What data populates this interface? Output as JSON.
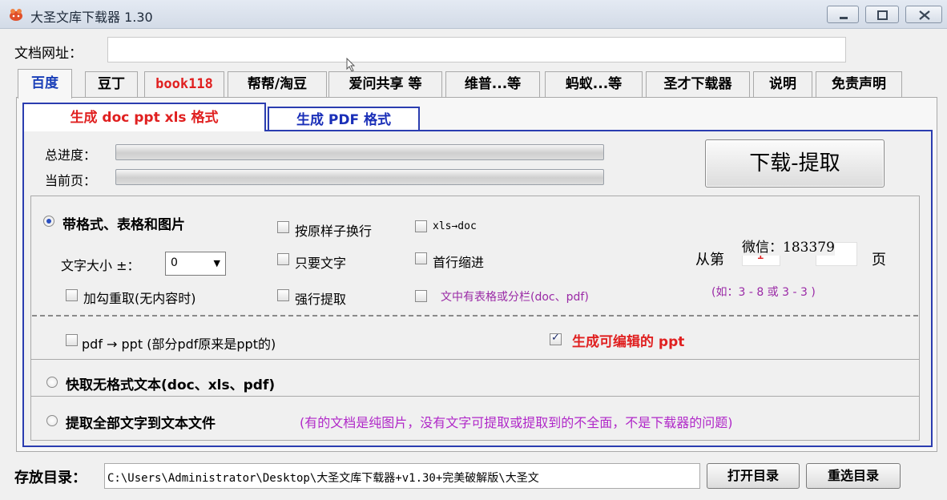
{
  "window": {
    "title": "大圣文库下载器 1.30"
  },
  "url_row": {
    "label": "文档网址：",
    "value": ""
  },
  "tabs": [
    {
      "label": "百度",
      "color": "#1a3fb8"
    },
    {
      "label": "豆丁",
      "color": "#000000"
    },
    {
      "label": "book118",
      "color": "#e02020"
    },
    {
      "label": "帮帮/淘豆",
      "color": "#000000"
    },
    {
      "label": "爱问共享 等",
      "color": "#000000"
    },
    {
      "label": "维普...等",
      "color": "#000000"
    },
    {
      "label": "蚂蚁...等",
      "color": "#000000"
    },
    {
      "label": "圣才下载器",
      "color": "#000000"
    },
    {
      "label": "说明",
      "color": "#000000"
    },
    {
      "label": "免责声明",
      "color": "#000000"
    }
  ],
  "subtabs": {
    "doc_label": "生成 doc ppt xls 格式",
    "pdf_label": "生成 PDF 格式"
  },
  "progress": {
    "total_label": "总进度：",
    "current_label": "当前页：",
    "total_value": 0,
    "current_value": 0
  },
  "download_button": "下载-提取",
  "options": {
    "with_format_label": "带格式、表格和图片",
    "font_size_label": "文字大小 ±：",
    "font_size_value": "0",
    "recheck_label": "加勾重取(无内容时)",
    "keep_linebreak_label": "按原样子换行",
    "text_only_label": "只要文字",
    "force_extract_label": "强行提取",
    "xls_doc_label": "xls→doc",
    "indent_label": "首行缩进",
    "table_column_label": "文中有表格或分栏(doc、pdf)",
    "page_from_label": "从第",
    "page_from_value": "1",
    "page_dash": "-",
    "page_to_value": "",
    "page_unit": "页",
    "wechat_overlay": "微信：183379",
    "page_example": "(如：3 - 8  或 3 - 3 )",
    "pdf_ppt_label": "pdf → ppt (部分pdf原来是ppt的)",
    "editable_ppt_label": "生成可编辑的 ppt",
    "editable_ppt_checked": true,
    "quick_text_label": "快取无格式文本(doc、xls、pdf)",
    "extract_all_label": "提取全部文字到文本文件",
    "extract_note": "(有的文档是纯图片，没有文字可提取或提取到的不全面，不是下载器的问题)"
  },
  "bottom": {
    "dir_label": "存放目录：",
    "dir_value": "C:\\Users\\Administrator\\Desktop\\大圣文库下载器+v1.30+完美破解版\\大圣文",
    "open_dir_button": "打开目录",
    "reselect_dir_button": "重选目录"
  },
  "colors": {
    "accent_blue": "#1a3fb8",
    "accent_red": "#e02020",
    "note_purple": "#b028c8",
    "example_purple": "#9a2aa6"
  }
}
